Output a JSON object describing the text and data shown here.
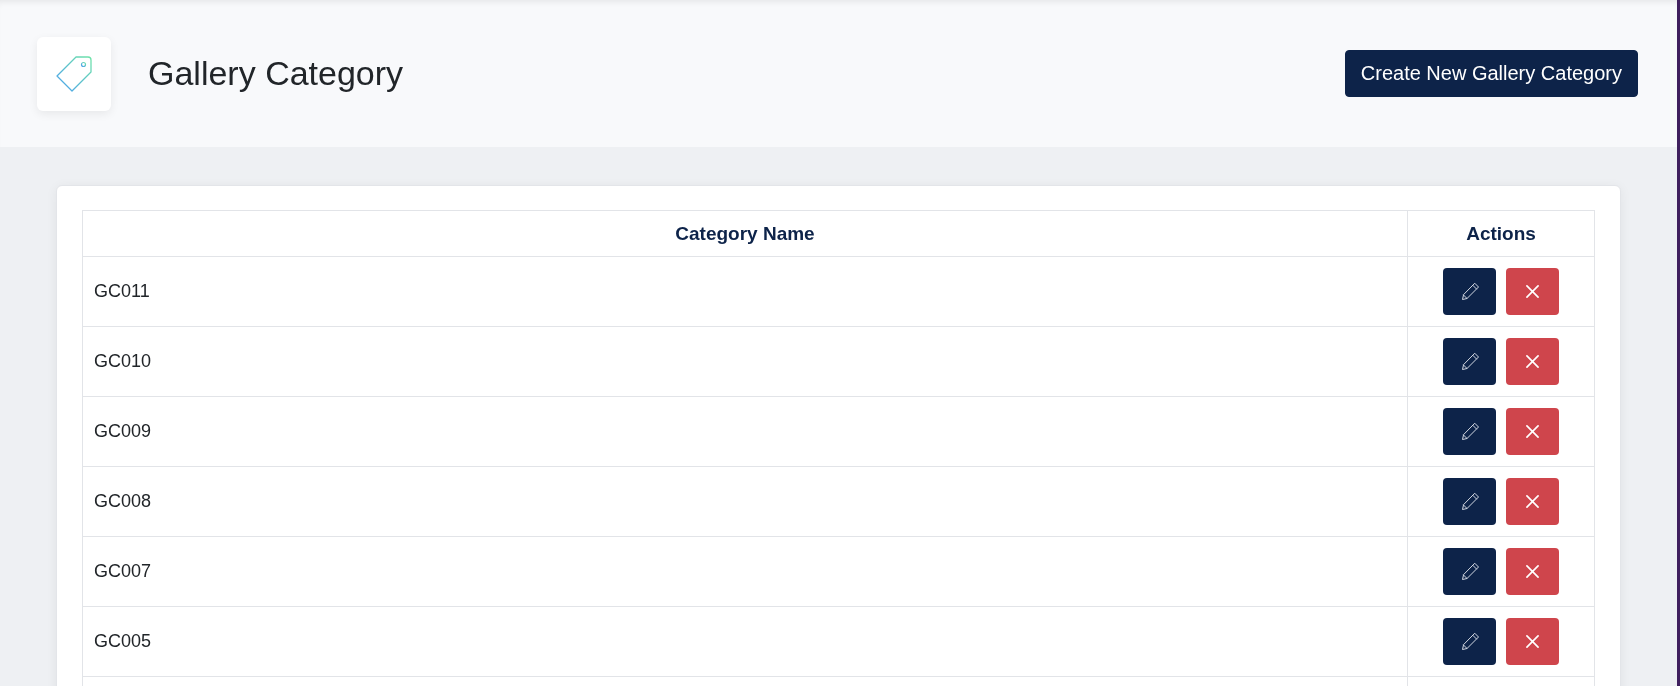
{
  "header": {
    "title": "Gallery Category",
    "create_button": "Create New Gallery Category"
  },
  "table": {
    "columns": [
      "Category Name",
      "Actions"
    ],
    "rows": [
      {
        "name": "GC011"
      },
      {
        "name": "GC010"
      },
      {
        "name": "GC009"
      },
      {
        "name": "GC008"
      },
      {
        "name": "GC007"
      },
      {
        "name": "GC005"
      }
    ]
  }
}
